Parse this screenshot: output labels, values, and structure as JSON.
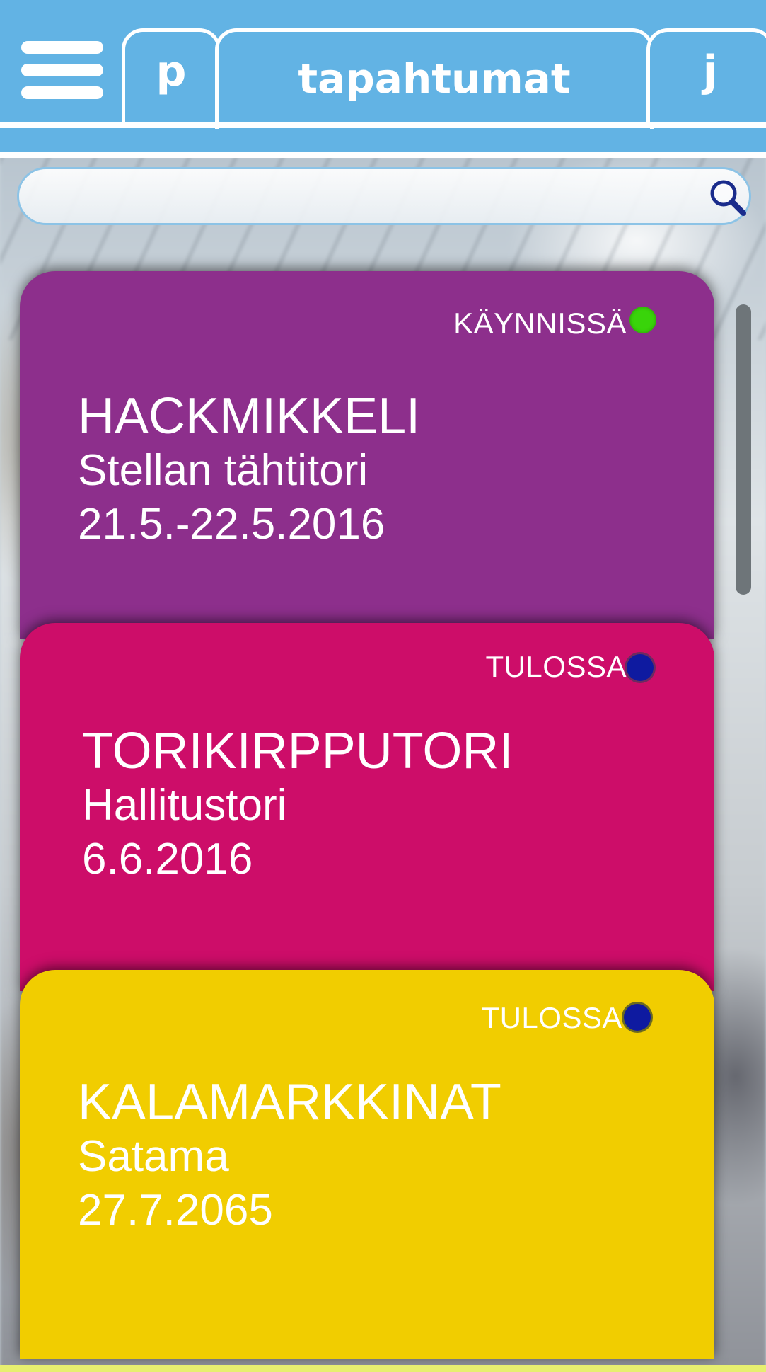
{
  "header": {
    "tab_left": "p",
    "tab_main": "tapahtumat",
    "tab_right": "j"
  },
  "search": {
    "value": "",
    "placeholder": ""
  },
  "events": [
    {
      "name": "HACKMIKKELI",
      "place": "Stellan tähtitori",
      "date": "21.5.-22.5.2016",
      "status": "KÄYNNISSÄ",
      "color": "#8d2f8c",
      "status_color": "#39d40a"
    },
    {
      "name": "TORIKIRPPUTORI",
      "place": "Hallitustori",
      "date": "6.6.2016",
      "status": "TULOSSA",
      "color": "#cd0d69",
      "status_color": "#0e1aa0"
    },
    {
      "name": "KALAMARKKINAT",
      "place": "Satama",
      "date": "27.7.2065",
      "status": "TULOSSA",
      "color": "#f1cd00",
      "status_color": "#0e1aa0"
    }
  ]
}
